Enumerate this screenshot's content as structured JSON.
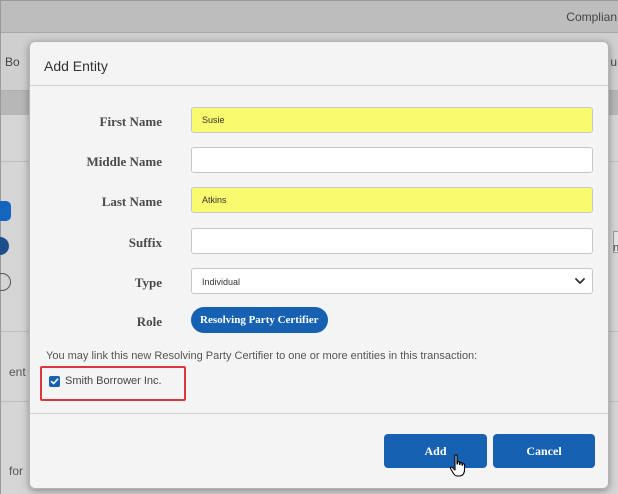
{
  "background": {
    "top_right_title": "Complian",
    "tab_left": "Bo",
    "tab_right": "u",
    "side_text_1": "ent",
    "side_text_2": "for",
    "right_edge_text": "n"
  },
  "dialog": {
    "title": "Add Entity",
    "fields": {
      "first_name": {
        "label": "First Name",
        "value": "Susie"
      },
      "middle_name": {
        "label": "Middle Name",
        "value": ""
      },
      "last_name": {
        "label": "Last Name",
        "value": "Atkins"
      },
      "suffix": {
        "label": "Suffix",
        "value": ""
      },
      "type": {
        "label": "Type",
        "value": "Individual"
      },
      "role": {
        "label": "Role",
        "value": "Resolving Party Certifier"
      }
    },
    "link_instruction": "You may link this new Resolving Party Certifier to one or more entities in this transaction:",
    "linked_entities": [
      {
        "label": "Smith Borrower Inc.",
        "checked": true
      }
    ],
    "buttons": {
      "add": "Add",
      "cancel": "Cancel"
    }
  },
  "colors": {
    "primary": "#1661b2",
    "highlight": "#fafa6e",
    "callout": "#d9363e"
  },
  "icons": {
    "type_dropdown": "chevron-down-icon",
    "checkbox": "checkmark-icon",
    "cursor": "hand-pointer-icon"
  }
}
